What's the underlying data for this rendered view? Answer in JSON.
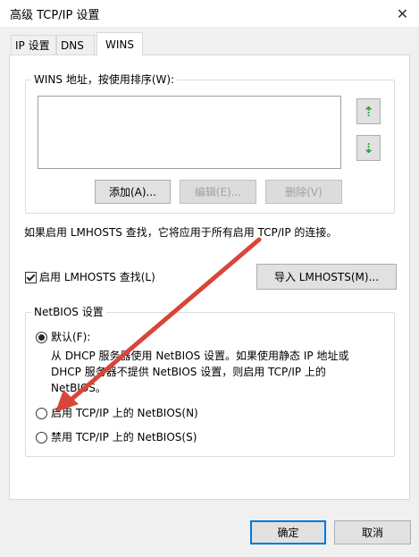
{
  "window": {
    "title": "高级 TCP/IP 设置",
    "close_glyph": "✕"
  },
  "tabs": [
    {
      "label": "IP 设置",
      "selected": false
    },
    {
      "label": "DNS",
      "selected": false
    },
    {
      "label": "WINS",
      "selected": true
    }
  ],
  "wins": {
    "group_label": "WINS 地址，按使用排序(W):",
    "up_arrow_glyph": "⇡",
    "down_arrow_glyph": "⇣",
    "add_label": "添加(A)...",
    "edit_label": "编辑(E)...",
    "remove_label": "删除(V)"
  },
  "lmhosts": {
    "info_text": "如果启用 LMHOSTS 查找，它将应用于所有启用 TCP/IP 的连接。",
    "checkbox_label": "启用 LMHOSTS 查找(L)",
    "checkbox_checked": true,
    "import_label": "导入 LMHOSTS(M)..."
  },
  "netbios": {
    "group_label": "NetBIOS 设置",
    "options": [
      {
        "label": "默认(F):",
        "selected": true
      },
      {
        "label": "启用 TCP/IP 上的 NetBIOS(N)",
        "selected": false
      },
      {
        "label": "禁用 TCP/IP 上的 NetBIOS(S)",
        "selected": false
      }
    ],
    "default_description_line1": "从 DHCP 服务器使用 NetBIOS 设置。如果使用静态 IP 地址或",
    "default_description_line2": "DHCP 服务器不提供 NetBIOS 设置，则启用 TCP/IP 上的",
    "default_description_line3": "NetBIOS。"
  },
  "footer": {
    "ok_label": "确定",
    "cancel_label": "取消"
  },
  "annotation": {
    "arrow_color": "#d9453a"
  }
}
